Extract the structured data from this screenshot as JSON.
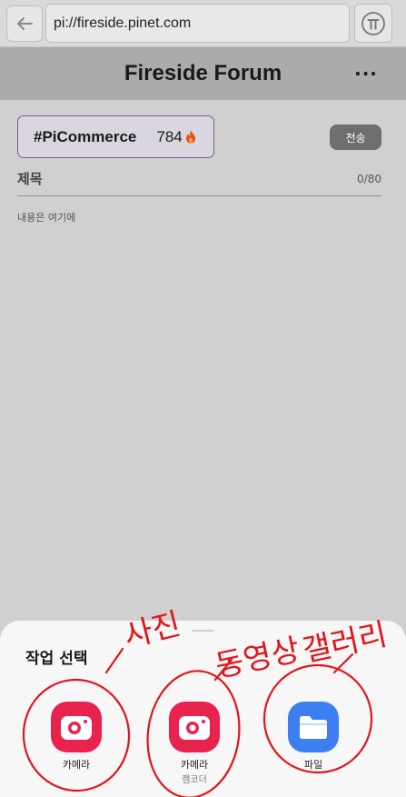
{
  "browser": {
    "url": "pi://fireside.pinet.com",
    "back_icon": "arrow-left-icon",
    "pi_icon": "pi-coin-icon"
  },
  "header": {
    "title": "Fireside Forum",
    "more_label": "···"
  },
  "composer": {
    "tag": "#PiCommerce",
    "tag_count": "784",
    "tag_icon": "flame-icon",
    "send_label": "전송",
    "title_label": "제목",
    "title_counter": "0/80",
    "content_placeholder": "내용은 여기에"
  },
  "sheet": {
    "title": "작업 선택",
    "actions": [
      {
        "label": "카메라",
        "sublabel": "",
        "icon": "camera-icon",
        "color": "#e8234f"
      },
      {
        "label": "카메라",
        "sublabel": "캠코더",
        "icon": "camera-icon",
        "color": "#e8234f"
      },
      {
        "label": "파일",
        "sublabel": "",
        "icon": "folder-icon",
        "color": "#3d7ff0"
      }
    ]
  },
  "annotations": {
    "photo": "사진",
    "video": "동영상",
    "gallery": "갤러리",
    "color": "#e0161b"
  }
}
